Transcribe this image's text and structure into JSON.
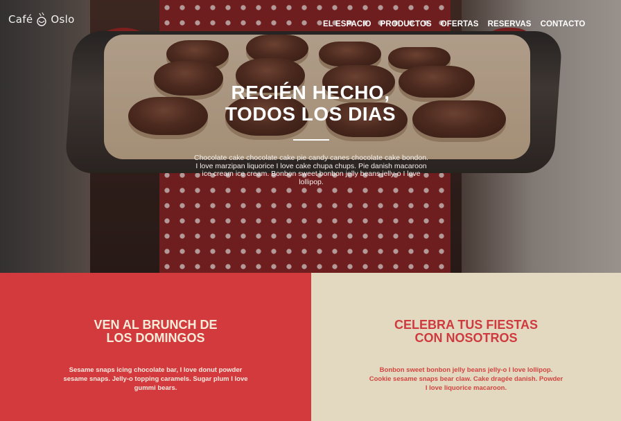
{
  "brand": {
    "name_left": "Café",
    "name_right": "Oslo",
    "logo_icon": "coffee-cup-icon"
  },
  "nav": {
    "items": [
      {
        "label": "EL ESPACIO"
      },
      {
        "label": "PRODUCTOS"
      },
      {
        "label": "OFERTAS"
      },
      {
        "label": "RESERVAS"
      },
      {
        "label": "CONTACTO"
      }
    ]
  },
  "hero": {
    "title_line1": "RECIÉN HECHO,",
    "title_line2": "TODOS LOS DIAS",
    "text": "Chocolate cake chocolate cake pie candy canes chocolate cake bondon. I love marzipan liquorice I love cake chupa chups. Pie danish macaroon ice cream ice cream. Bonbon sweet bonbon jelly beans jelly-o I love lollipop."
  },
  "panels": [
    {
      "title_line1": "VEN AL BRUNCH DE",
      "title_line2": "LOS DOMINGOS",
      "text": "Sesame snaps icing chocolate bar, I love donut powder sesame snaps. Jelly-o topping caramels. Sugar plum I love gummi bears.",
      "background": "#d23a3d"
    },
    {
      "title_line1": "CELEBRA TUS FIESTAS",
      "title_line2": "CON NOSOTROS",
      "text": "Bonbon sweet bonbon jelly beans jelly-o I love lollipop. Cookie sesame snaps bear claw. Cake dragée danish. Powder I love liquorice macaroon.",
      "background": "#e3d9c1"
    }
  ],
  "colors": {
    "accent_red": "#d23a3d",
    "cream": "#e3d9c1"
  }
}
